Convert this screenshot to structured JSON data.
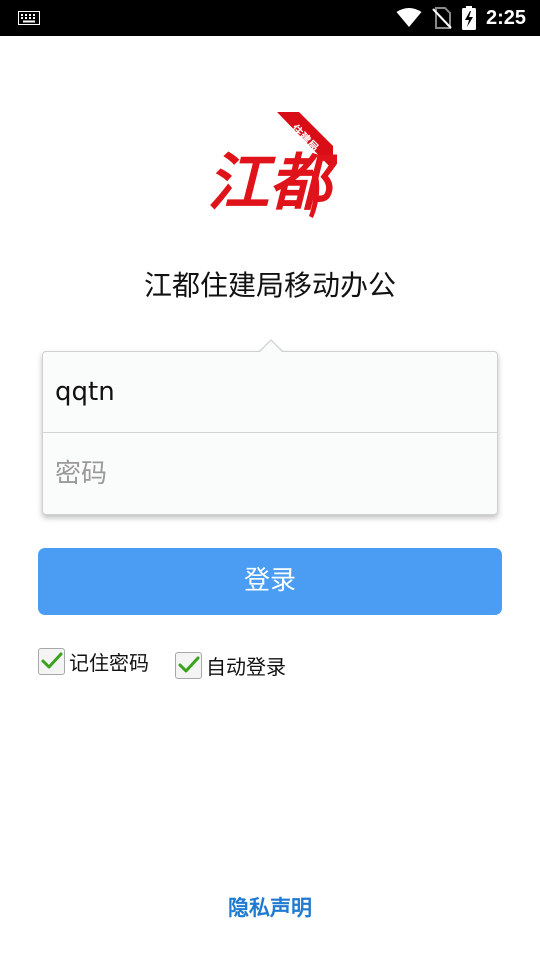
{
  "status_bar": {
    "time": "2:25",
    "icons": [
      "keyboard-icon",
      "wifi-icon",
      "no-sim-icon",
      "battery-charging-icon"
    ]
  },
  "logo": {
    "main_text": "江都",
    "ribbon_text": "住建局",
    "colors": {
      "primary": "#e0121a",
      "ribbon": "#d80d15"
    }
  },
  "app": {
    "title": "江都住建局移动办公"
  },
  "login_form": {
    "username_value": "qqtn",
    "password_placeholder": "密码"
  },
  "login_button": {
    "label": "登录",
    "color": "#4a9df2"
  },
  "options": {
    "remember_password": {
      "label": "记住密码",
      "checked": true
    },
    "auto_login": {
      "label": "自动登录",
      "checked": true
    },
    "check_color": "#3aa31e"
  },
  "footer": {
    "privacy_label": "隐私声明",
    "link_color": "#1f7bd1"
  }
}
